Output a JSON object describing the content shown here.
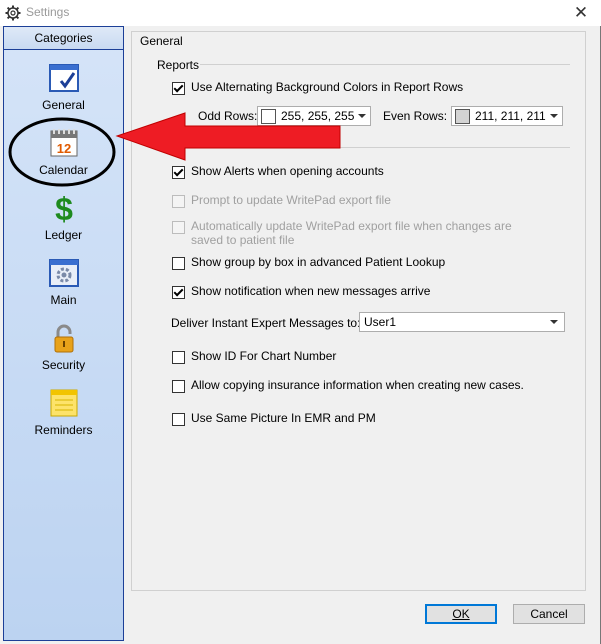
{
  "window": {
    "title": "Settings",
    "close_glyph": "✕"
  },
  "sidebar": {
    "header": "Categories",
    "items": [
      {
        "label": "General",
        "icon": "checklist-icon"
      },
      {
        "label": "Calendar",
        "icon": "calendar-icon",
        "icon_text": "12"
      },
      {
        "label": "Ledger",
        "icon": "dollar-icon",
        "icon_text": "$"
      },
      {
        "label": "Main",
        "icon": "gear-window-icon"
      },
      {
        "label": "Security",
        "icon": "padlock-icon"
      },
      {
        "label": "Reminders",
        "icon": "sticky-note-icon"
      }
    ]
  },
  "main": {
    "group_title": "General",
    "reports_title": "Reports",
    "alternating": {
      "label": "Use Alternating Background Colors in Report Rows",
      "checked": true
    },
    "odd_rows": {
      "label": "Odd Rows:",
      "value": "255, 255, 255",
      "swatch": "#ffffff"
    },
    "even_rows": {
      "label": "Even Rows:",
      "value": "211, 211, 211",
      "swatch": "#d3d3d3"
    },
    "options": [
      {
        "label": "Show Alerts when opening accounts",
        "checked": true,
        "disabled": false
      },
      {
        "label": "Prompt to update WritePad export file",
        "checked": false,
        "disabled": true
      },
      {
        "label": "Automatically update WritePad export file when changes are saved to patient file",
        "checked": false,
        "disabled": true
      },
      {
        "label": "Show group by box in advanced Patient Lookup",
        "checked": false,
        "disabled": false
      },
      {
        "label": "Show notification when new messages arrive",
        "checked": true,
        "disabled": false
      }
    ],
    "instant_expert": {
      "label": "Deliver Instant Expert Messages to:",
      "value": "User1"
    },
    "options2": [
      {
        "label": "Show ID For Chart Number",
        "checked": false
      },
      {
        "label": "Allow copying insurance information when creating new cases.",
        "checked": false
      },
      {
        "label": "Use Same Picture In EMR and PM",
        "checked": false
      }
    ]
  },
  "buttons": {
    "ok": "OK",
    "cancel": "Cancel"
  },
  "colors": {
    "sidebar_border": "#1c3f97",
    "annotation_arrow": "#ee1c24",
    "default_button_border": "#0078d7"
  }
}
